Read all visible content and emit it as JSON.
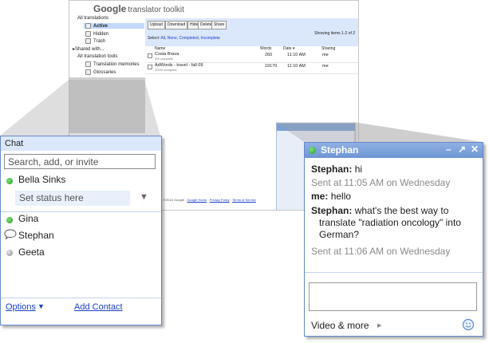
{
  "toolkit": {
    "logo_brand": "Google",
    "logo_rest": "translator toolkit",
    "sidebar": {
      "all_translations": "All translations",
      "active": "Active",
      "hidden": "Hidden",
      "trash": "Trash",
      "shared_with": "Shared with...",
      "all_tools": "All translation tools",
      "memories": "Translation memories",
      "glossaries": "Glossaries"
    },
    "toolbar": {
      "upload": "Upload",
      "download": "Download",
      "hide": "Hide",
      "delete": "Delete",
      "share": "Share"
    },
    "showing": "Showing items 1-2 of 2",
    "select_label": "Select:",
    "select_all": "All",
    "select_none": "None",
    "select_completed": "Completed",
    "select_incomplete": "Incomplete",
    "columns": {
      "name": "Name",
      "words": "Words",
      "date": "Date",
      "sharing": "Sharing"
    },
    "rows": [
      {
        "name": "Costa Brava",
        "sub": "3% complete",
        "words": "260",
        "date": "11:10 AM",
        "sharing": "me"
      },
      {
        "name": "AdWords - travel - fall 09",
        "sub": "100% complete",
        "words": "19170",
        "date": "11:10 AM",
        "sharing": "me"
      }
    ],
    "footer_copy": "©2010 Google -",
    "footer_home": "Google Home",
    "footer_privacy": "Privacy Policy",
    "footer_terms": "Terms of Service"
  },
  "chat": {
    "title": "Chat",
    "search_placeholder": "Search, add, or invite",
    "self_name": "Bella Sinks",
    "status_placeholder": "Set status here",
    "contacts": [
      {
        "name": "Gina",
        "status": "online"
      },
      {
        "name": "Stephan",
        "status": "chatting"
      },
      {
        "name": "Geeta",
        "status": "offline"
      }
    ],
    "options_label": "Options",
    "add_contact_label": "Add Contact"
  },
  "conversation": {
    "title": "Stephan",
    "messages": [
      {
        "sender": "Stephan:",
        "text": "hi"
      },
      {
        "sender": "me:",
        "text": "hello"
      },
      {
        "sender": "Stephan:",
        "text": "what's the best way to",
        "text_cont1": "translate \"radiation oncology\" into",
        "text_cont2": "German?"
      }
    ],
    "timestamps": [
      "Sent at 11:05 AM on Wednesday",
      "Sent at 11:06 AM on Wednesday"
    ],
    "video_more_label": "Video & more"
  },
  "colors": {
    "accent_blue": "#6e95d4",
    "header_light": "#dbe7fb",
    "link": "#1a3fc4",
    "online_green": "#1ea21e"
  }
}
